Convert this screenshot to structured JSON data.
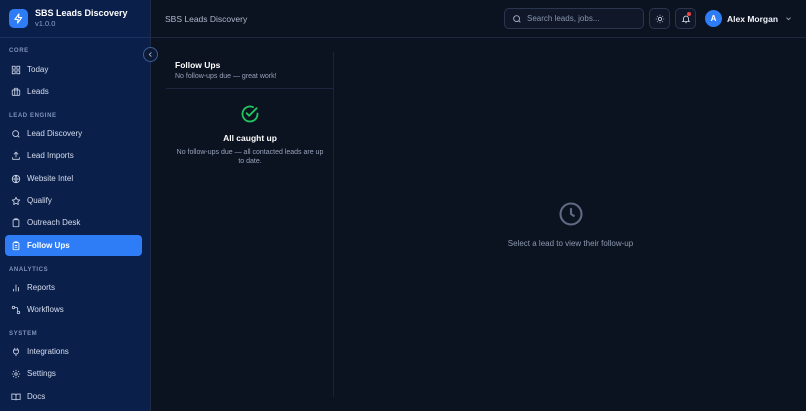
{
  "brand": {
    "name": "SBS Leads Discovery",
    "version": "v1.0.0"
  },
  "header": {
    "title": "SBS Leads Discovery",
    "search_placeholder": "Search leads, jobs...",
    "user_initial": "A",
    "user_name": "Alex Morgan"
  },
  "sidebar": {
    "sections": {
      "core": "CORE",
      "lead_engine": "LEAD ENGINE",
      "analytics": "ANALYTICS",
      "system": "SYSTEM"
    },
    "items": {
      "today": "Today",
      "leads": "Leads",
      "lead_discovery": "Lead Discovery",
      "lead_imports": "Lead Imports",
      "website_intel": "Website Intel",
      "qualify": "Qualify",
      "outreach_desk": "Outreach Desk",
      "follow_ups": "Follow Ups",
      "reports": "Reports",
      "workflows": "Workflows",
      "integrations": "Integrations",
      "settings": "Settings",
      "docs": "Docs"
    },
    "active": "follow_ups"
  },
  "follow_ups": {
    "title": "Follow Ups",
    "subtitle": "No follow-ups due — great work!",
    "empty_title": "All caught up",
    "empty_text": "No follow-ups due — all contacted leads are up to date."
  },
  "detail": {
    "empty_text": "Select a lead to view their follow-up"
  },
  "colors": {
    "accent": "#2f7df6",
    "sidebar_bg": "#0a1f4a",
    "page_bg": "#0b1220",
    "success": "#22c55e",
    "notification": "#ef4444"
  }
}
